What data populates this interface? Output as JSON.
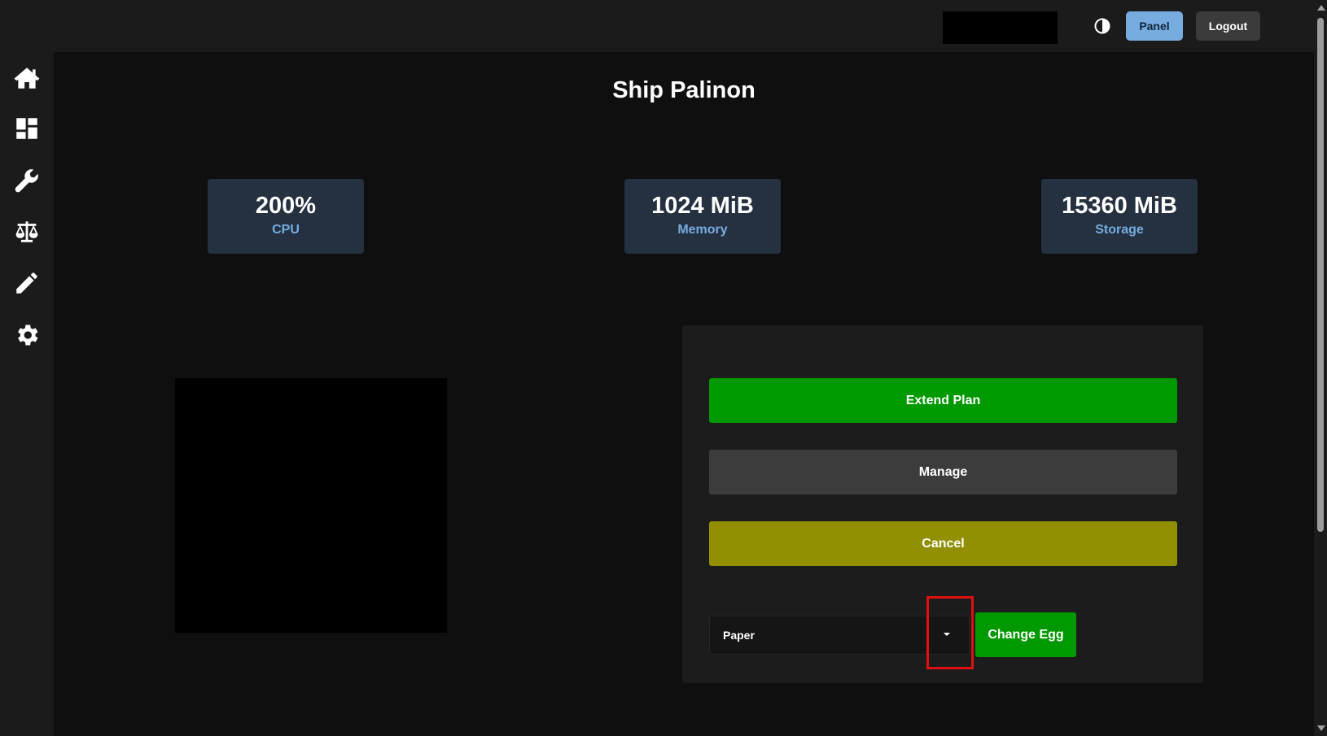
{
  "header": {
    "theme_toggle_icon": "contrast-icon",
    "panel_label": "Panel",
    "logout_label": "Logout"
  },
  "sidebar": {
    "items": [
      {
        "icon": "home-icon"
      },
      {
        "icon": "dashboard-icon"
      },
      {
        "icon": "wrench-icon"
      },
      {
        "icon": "scale-icon"
      },
      {
        "icon": "pencil-icon"
      },
      {
        "icon": "gear-icon"
      }
    ]
  },
  "main": {
    "title": "Ship Palinon",
    "stats": [
      {
        "value": "200%",
        "label": "CPU"
      },
      {
        "value": "1024 MiB",
        "label": "Memory"
      },
      {
        "value": "15360 MiB",
        "label": "Storage"
      }
    ],
    "actions": {
      "extend_label": "Extend Plan",
      "manage_label": "Manage",
      "cancel_label": "Cancel",
      "egg_selected": "Paper",
      "change_egg_label": "Change Egg"
    }
  },
  "colors": {
    "accent_blue": "#77ace0",
    "success_green": "#009900",
    "cancel_olive": "#929000",
    "card_bg": "#253141",
    "highlight_red": "#e01010"
  }
}
